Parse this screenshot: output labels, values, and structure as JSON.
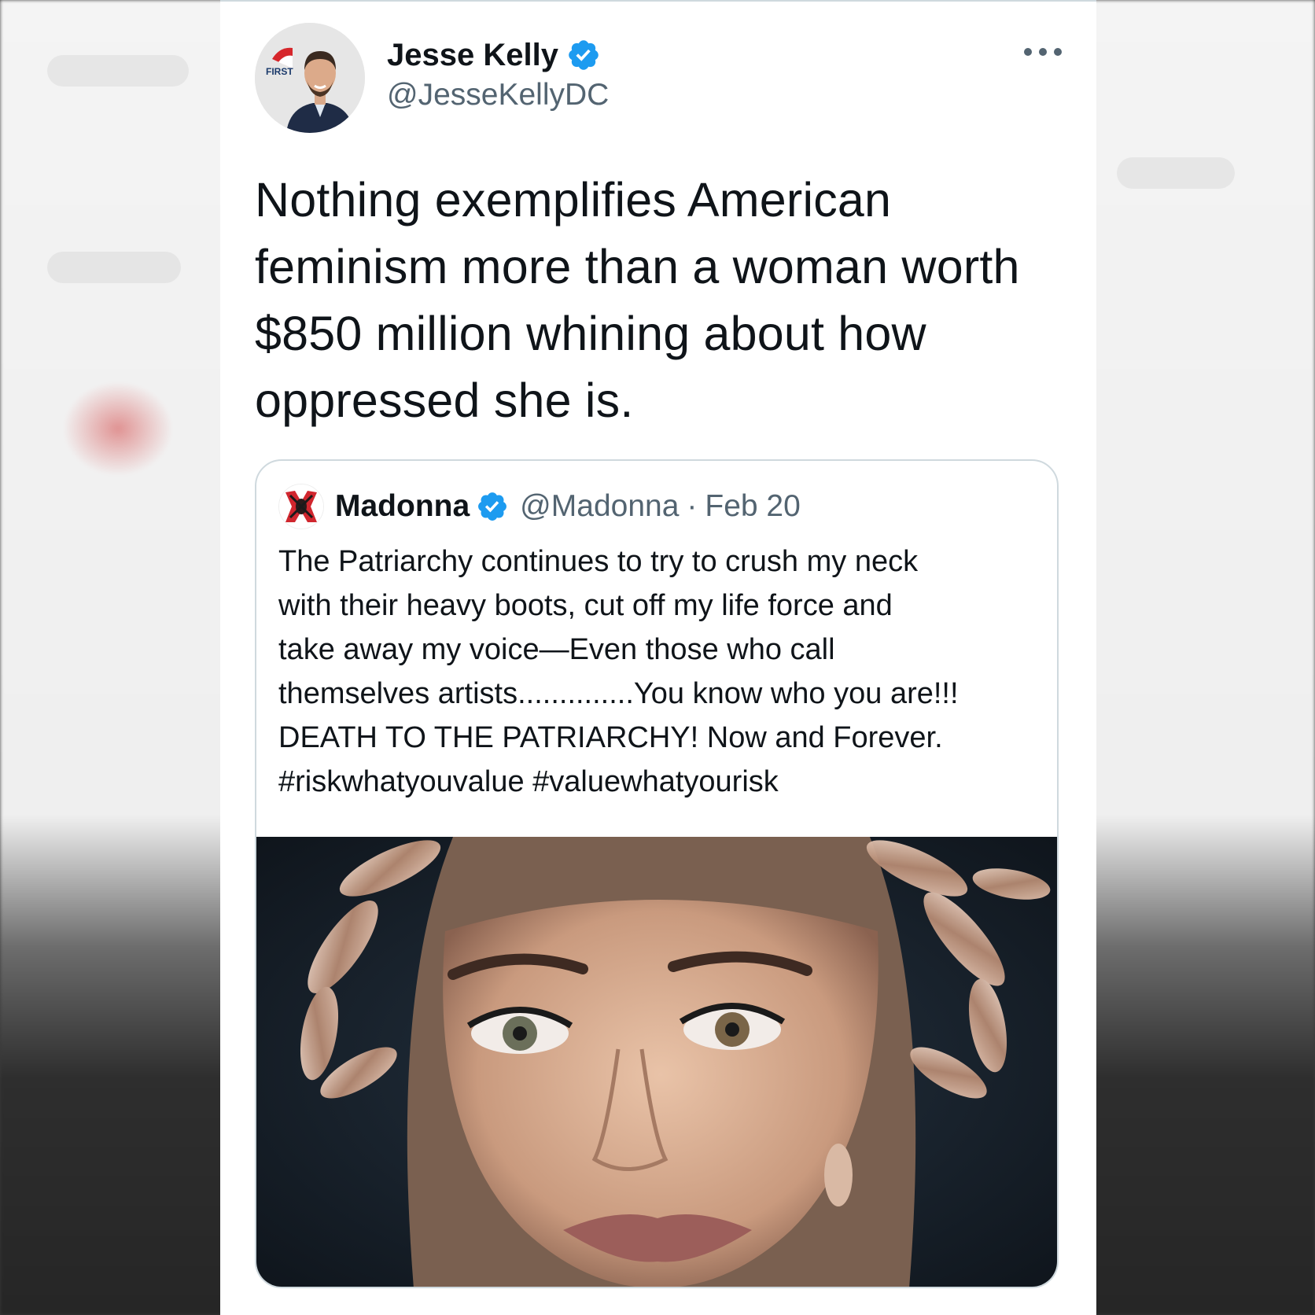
{
  "colors": {
    "text_primary": "#0f1419",
    "text_secondary": "#536471",
    "verified_blue": "#1d9bf0",
    "border": "#cfd9de"
  },
  "tweet": {
    "author": {
      "display_name": "Jesse Kelly",
      "handle": "@JesseKellyDC",
      "verified": true,
      "avatar_icon": "profile-photo-avatar",
      "avatar_logo_text": "FIRST"
    },
    "more_icon": "more-options-icon",
    "text": "Nothing exemplifies American feminism more than a woman worth $850 million whining about how oppressed she is."
  },
  "quoted_tweet": {
    "author": {
      "display_name": "Madonna",
      "handle": "@Madonna",
      "verified": true,
      "avatar_icon": "madonna-avatar"
    },
    "separator": "·",
    "date": "Feb 20",
    "text_lines": [
      "The Patriarchy continues to try to crush my neck",
      "with their heavy boots, cut off my life force and",
      "take away my voice—Even those who call",
      "themselves artists..............You know who you are!!!",
      "DEATH TO THE PATRIARCHY! Now and Forever.",
      "#riskwhatyouvalue #valuewhatyourisk"
    ],
    "media": {
      "type": "photo",
      "icon": "portrait-photo"
    }
  }
}
